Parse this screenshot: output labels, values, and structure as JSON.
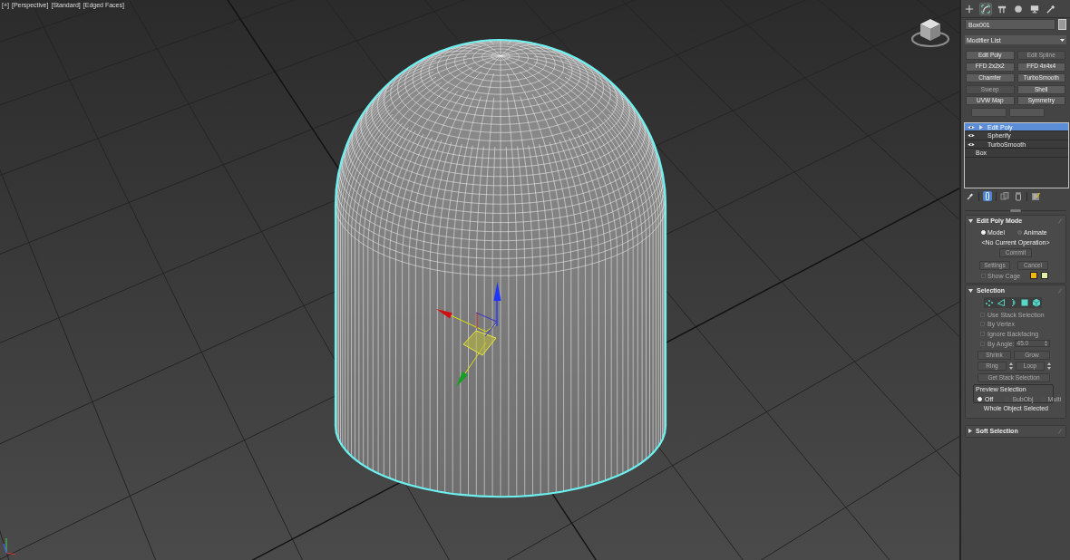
{
  "viewport": {
    "labels": [
      "[+]",
      "[Perspective]",
      "[Standard]",
      "[Edged Faces]"
    ]
  },
  "command_panel": {
    "tabs": [
      {
        "kind": "create",
        "selected": false
      },
      {
        "kind": "modify",
        "selected": true
      },
      {
        "kind": "hierarchy",
        "selected": false
      },
      {
        "kind": "motion",
        "selected": false
      },
      {
        "kind": "display",
        "selected": false
      },
      {
        "kind": "utilities",
        "selected": false
      }
    ],
    "object_name": "Box001",
    "modifier_list": "Modifier List",
    "modifier_buttons": [
      {
        "label": "Edit Poly",
        "disabled": false
      },
      {
        "label": "Edit Spline",
        "disabled": true
      },
      {
        "label": "FFD 2x2x2",
        "disabled": false
      },
      {
        "label": "FFD 4x4x4",
        "disabled": false
      },
      {
        "label": "Chamfer",
        "disabled": false
      },
      {
        "label": "TurboSmooth",
        "disabled": false
      },
      {
        "label": "Sweep",
        "disabled": true
      },
      {
        "label": "Shell",
        "disabled": false
      },
      {
        "label": "UVW Map",
        "disabled": false
      },
      {
        "label": "Symmetry",
        "disabled": false
      }
    ],
    "modifier_stack": [
      {
        "kind": "modifier",
        "label": "Edit Poly",
        "selected": true,
        "expandable": true
      },
      {
        "kind": "modifier",
        "label": "Spherify",
        "selected": false,
        "expandable": false
      },
      {
        "kind": "modifier",
        "label": "TurboSmooth",
        "selected": false,
        "expandable": false
      },
      {
        "kind": "base",
        "label": "Box",
        "selected": false
      }
    ],
    "stack_tools": [
      {
        "kind": "pin",
        "selected": false
      },
      {
        "kind": "show_end_result",
        "selected": true
      },
      {
        "kind": "make_unique",
        "selected": false
      },
      {
        "kind": "remove",
        "selected": false
      },
      {
        "kind": "configure",
        "selected": false
      }
    ],
    "rollouts": [
      {
        "kind": "edit_poly_mode",
        "title": "Edit Poly Mode",
        "expanded": true,
        "mode_options": [
          {
            "label": "Model",
            "selected": true
          },
          {
            "label": "Animate",
            "selected": false
          }
        ],
        "operation": "<No Current Operation>",
        "commit": {
          "label": "Commit",
          "disabled": true
        },
        "buttons": [
          {
            "label": "Settings",
            "disabled": true
          },
          {
            "label": "Cancel",
            "disabled": true
          }
        ],
        "show_cage": {
          "label": "Show Cage",
          "checked": false,
          "disabled": true
        },
        "cage_colors": [
          {
            "color": "#f5b800"
          },
          {
            "color": "#e4eea6"
          }
        ]
      },
      {
        "kind": "selection",
        "title": "Selection",
        "expanded": true,
        "subobject_levels": [
          {
            "kind": "vertex",
            "selected": false
          },
          {
            "kind": "edge",
            "selected": false
          },
          {
            "kind": "border",
            "selected": false
          },
          {
            "kind": "polygon",
            "selected": false
          },
          {
            "kind": "element",
            "selected": false
          }
        ],
        "options": [
          {
            "kind": "check",
            "label": "Use Stack Selection",
            "checked": false,
            "disabled": true
          },
          {
            "kind": "check",
            "label": "By Vertex",
            "checked": false,
            "disabled": true
          },
          {
            "kind": "check",
            "label": "Ignore Backfacing",
            "checked": false,
            "disabled": true
          },
          {
            "kind": "check_value",
            "label": "By Angle:",
            "checked": false,
            "disabled": true,
            "value": "45.0"
          }
        ],
        "button_rows": [
          [
            {
              "label": "Shrink",
              "disabled": true
            },
            {
              "label": "Grow",
              "disabled": true
            }
          ],
          [
            {
              "label": "Ring",
              "disabled": true,
              "spinner": true
            },
            {
              "label": "Loop",
              "disabled": true,
              "spinner": true
            }
          ],
          [
            {
              "label": "Get Stack Selection",
              "disabled": true
            }
          ]
        ],
        "preview_selection": {
          "title": "Preview Selection",
          "options": [
            {
              "label": "Off",
              "selected": true,
              "disabled": false
            },
            {
              "label": "SubObj",
              "selected": false,
              "disabled": true
            },
            {
              "label": "Multi",
              "selected": false,
              "disabled": true
            }
          ]
        },
        "status": "Whole Object Selected"
      },
      {
        "kind": "soft_selection",
        "title": "Soft Selection",
        "expanded": false
      }
    ]
  }
}
